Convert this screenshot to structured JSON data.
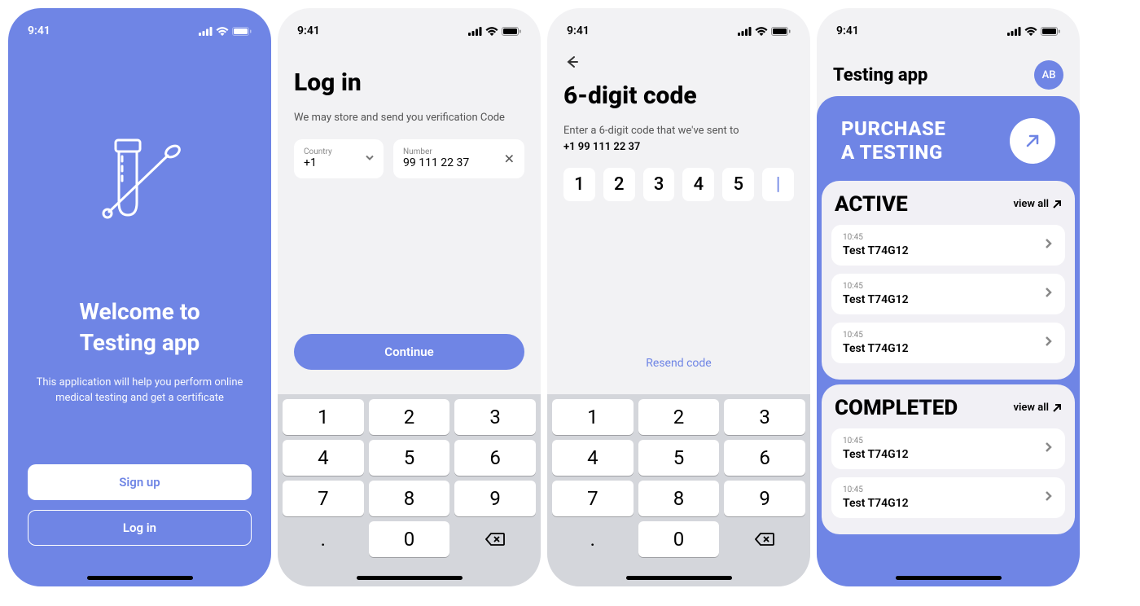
{
  "status_time": "9:41",
  "screen1": {
    "title_line1": "Welcome to",
    "title_line2": "Testing app",
    "desc": "This application will help you perform online medical testing  and get a certificate",
    "signup": "Sign up",
    "login": "Log in"
  },
  "screen2": {
    "title": "Log in",
    "sub": "We may store and send you verification Code",
    "country_label": "Country",
    "country_value": "+1",
    "number_label": "Number",
    "number_value": "99 111 22 37",
    "continue": "Continue"
  },
  "screen3": {
    "title": "6-digit code",
    "sub": "Enter a 6-digit code that we've sent to",
    "phone": "+1 99 111 22 37",
    "digits": [
      "1",
      "2",
      "3",
      "4",
      "5",
      ""
    ],
    "resend": "Resend code"
  },
  "keypad": [
    "1",
    "2",
    "3",
    "4",
    "5",
    "6",
    "7",
    "8",
    "9",
    ".",
    "0",
    "del"
  ],
  "screen4": {
    "app_title": "Testing app",
    "avatar": "AB",
    "purchase_line1": "PURCHASE",
    "purchase_line2": "A TESTING",
    "active_title": "ACTIVE",
    "completed_title": "COMPLETED",
    "view_all": "view all",
    "active_items": [
      {
        "time": "10:45",
        "name": "Test T74G12"
      },
      {
        "time": "10:45",
        "name": "Test T74G12"
      },
      {
        "time": "10:45",
        "name": "Test T74G12"
      }
    ],
    "completed_items": [
      {
        "time": "10:45",
        "name": "Test T74G12"
      },
      {
        "time": "10:45",
        "name": "Test T74G12"
      }
    ]
  }
}
